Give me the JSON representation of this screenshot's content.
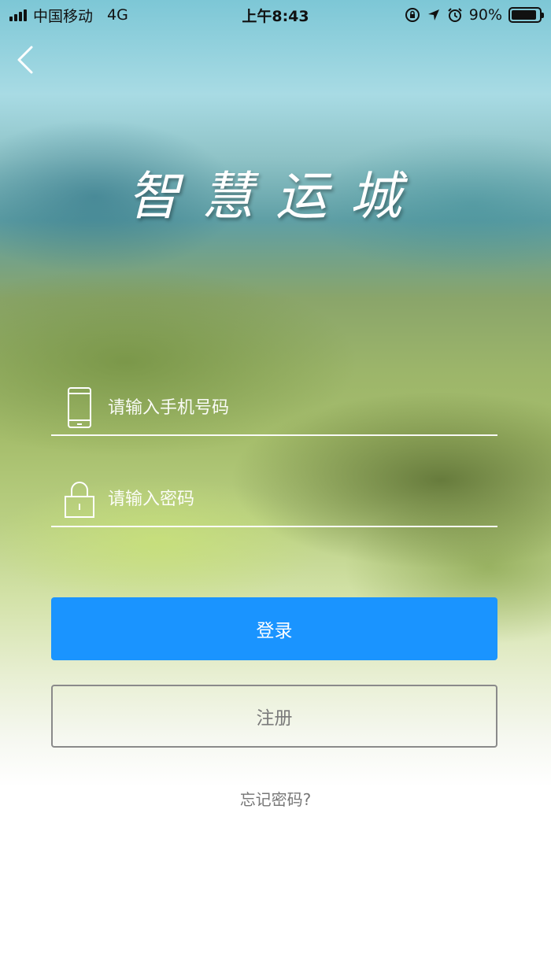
{
  "status_bar": {
    "carrier": "中国移动",
    "network": "4G",
    "time": "上午8:43",
    "battery": "90%",
    "battery_level": 0.9
  },
  "title": "智慧运城",
  "phone_field": {
    "placeholder": "请输入手机号码",
    "value": ""
  },
  "password_field": {
    "placeholder": "请输入密码",
    "value": ""
  },
  "buttons": {
    "login": "登录",
    "register": "注册"
  },
  "forgot_password": "忘记密码?",
  "colors": {
    "primary": "#1a94ff",
    "register_border": "#8a8a8a"
  },
  "icons": [
    "back-chevron-icon",
    "phone-icon",
    "lock-icon",
    "orientation-lock-icon",
    "location-arrow-icon",
    "alarm-icon",
    "battery-icon",
    "signal-icon"
  ]
}
